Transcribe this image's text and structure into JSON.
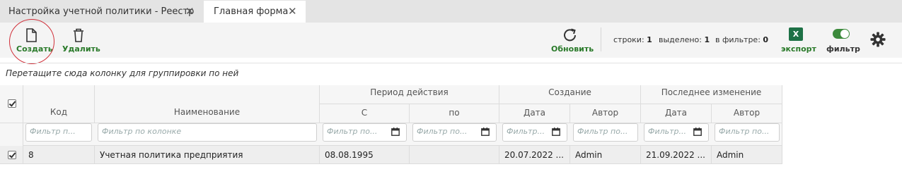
{
  "tabs": [
    {
      "label": "Настройка учетной политики - Реестр"
    },
    {
      "label": "Главная форма"
    }
  ],
  "tab_close": "✕",
  "toolbar": {
    "create_label": "Создать",
    "delete_label": "Удалить",
    "refresh_label": "Обновить",
    "rows_label": "строки:",
    "rows_value": "1",
    "selected_label": "выделено:",
    "selected_value": "1",
    "filtered_label": "в фильтре:",
    "filtered_value": "0",
    "excel_glyph": "X",
    "export_label": "экспорт",
    "filter_label": "фильтр",
    "filter_on": true,
    "accent_color": "#2a7a2a"
  },
  "grid": {
    "group_hint": "Перетащите сюда колонку для группировки по ней",
    "groups": {
      "period": "Период действия",
      "created": "Создание",
      "modified": "Последнее изменение"
    },
    "columns": {
      "code": "Код",
      "name": "Наименование",
      "from": "С",
      "to": "по",
      "created_date": "Дата",
      "created_author": "Автор",
      "modified_date": "Дата",
      "modified_author": "Автор"
    },
    "filters": {
      "code": "Фильтр п...",
      "name": "Фильтр по колонке",
      "from": "Фильтр по...",
      "to": "Фильтр по...",
      "created_date": "Фильтр...",
      "created_author": "Фильтр по...",
      "modified_date": "Фильтр...",
      "modified_author": "Фильтр по..."
    },
    "rows": [
      {
        "selected": true,
        "code": "8",
        "name": "Учетная политика предприятия",
        "from": "08.08.1995",
        "to": "",
        "created_date": "20.07.2022 ...",
        "created_author": "Admin",
        "modified_date": "21.09.2022 ...",
        "modified_author": "Admin"
      }
    ]
  }
}
